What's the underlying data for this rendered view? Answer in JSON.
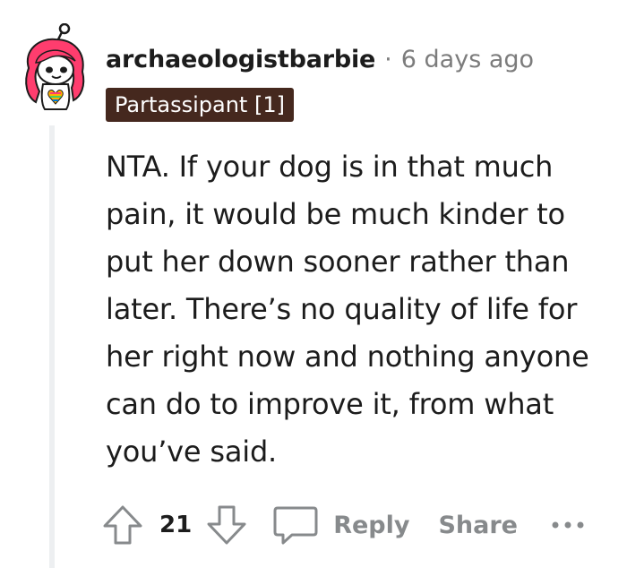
{
  "comment": {
    "username": "archaeologistbarbie",
    "separator": "·",
    "timestamp": "6 days ago",
    "flair": "Partassipant [1]",
    "body": "NTA. If your dog is in that much pain, it would be much kinder to put her down sooner rather than later. There’s no quality of life for her right now and nothing anyone can do to improve it, from what you’ve said.",
    "votes": "21",
    "reply_label": "Reply",
    "share_label": "Share",
    "icons": {
      "upvote": "upvote-arrow-icon",
      "downvote": "downvote-arrow-icon",
      "reply": "speech-bubble-icon",
      "more": "ellipsis-icon"
    }
  },
  "colors": {
    "flair_background": "#45281e",
    "flair_text": "#ffffff",
    "muted_text": "#878a8c",
    "thread_line": "#edeff1",
    "avatar_hair": "#ff3d6e"
  }
}
